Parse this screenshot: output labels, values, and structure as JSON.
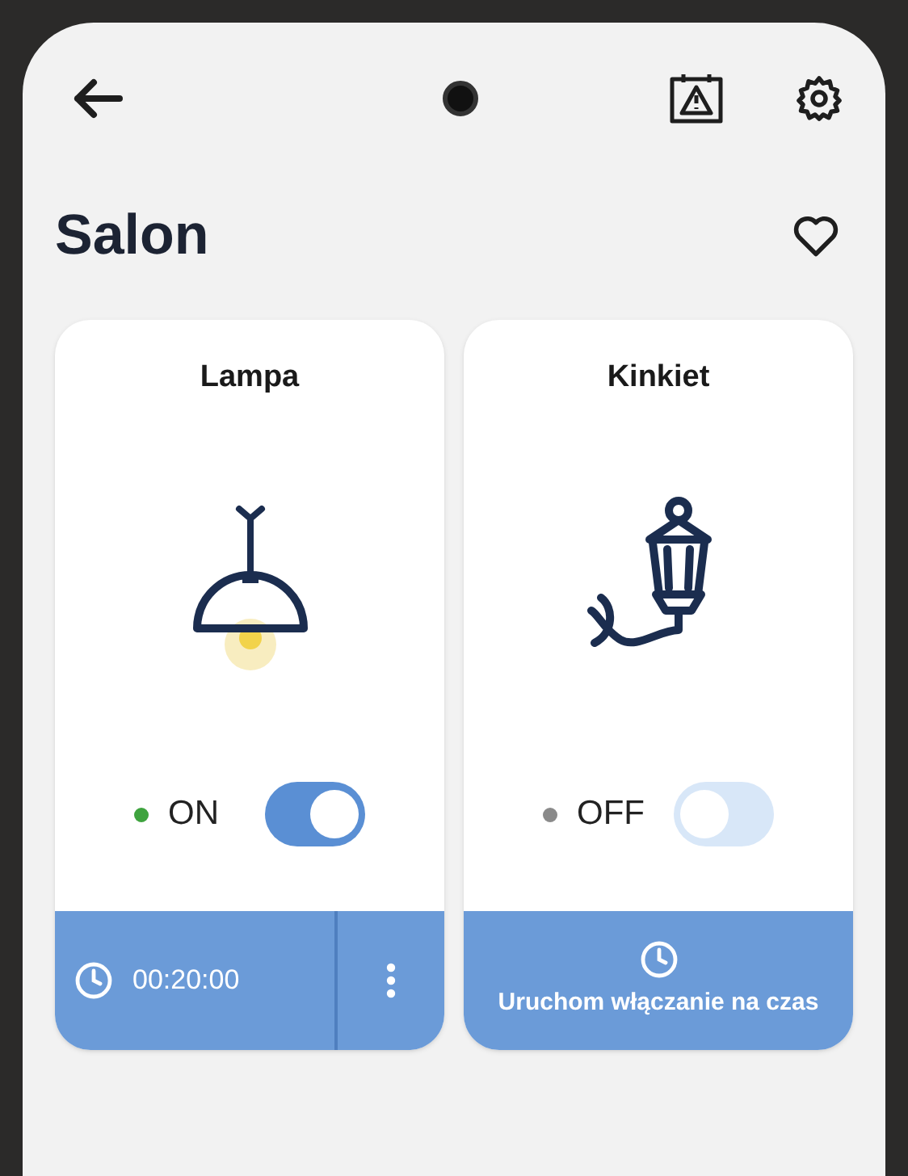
{
  "header": {
    "title": "Salon",
    "favorite": false
  },
  "devices": [
    {
      "name": "Lampa",
      "kind": "lamp",
      "on": true,
      "status": "ON",
      "action": {
        "kind": "timer",
        "time": "00:20:00"
      }
    },
    {
      "name": "Kinkiet",
      "kind": "sconce",
      "on": false,
      "status": "OFF",
      "action": {
        "kind": "start",
        "label": "Uruchom włączanie na czas"
      }
    }
  ]
}
